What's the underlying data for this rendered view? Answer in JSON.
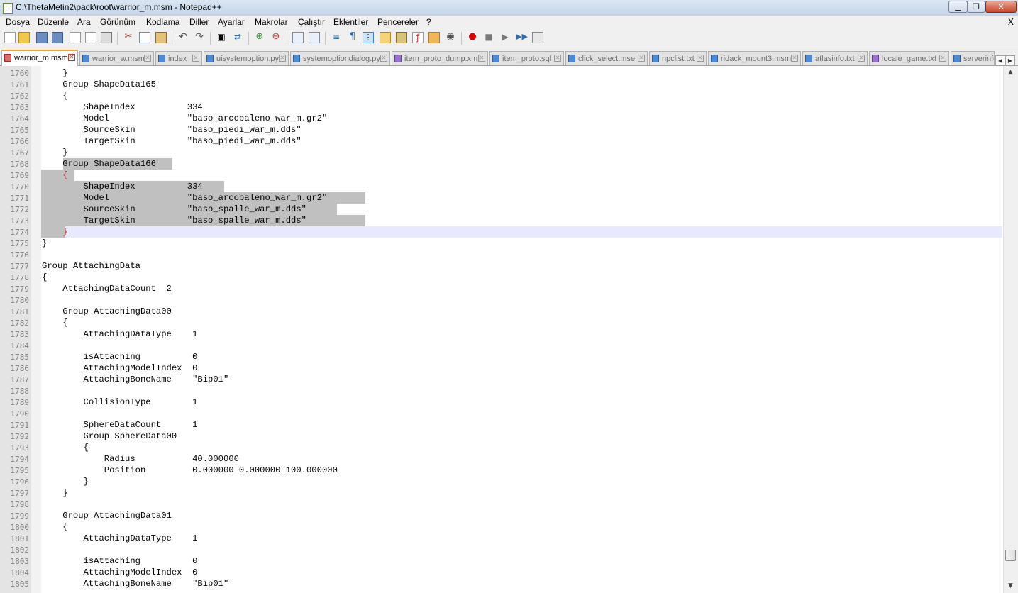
{
  "window": {
    "title": "C:\\ThetaMetin2\\pack\\root\\warrior_m.msm - Notepad++",
    "min_label": "▁",
    "max_label": "❐",
    "close_label": "✕"
  },
  "menu": {
    "items": [
      "Dosya",
      "Düzenle",
      "Ara",
      "Görünüm",
      "Kodlama",
      "Diller",
      "Ayarlar",
      "Makrolar",
      "Çalıştır",
      "Eklentiler",
      "Pencereler",
      "?"
    ],
    "close": "X"
  },
  "toolbar": {
    "icons": [
      "new-file-icon",
      "open-file-icon",
      "save-icon",
      "save-all-icon",
      "close-icon",
      "close-all-icon",
      "print-icon",
      "cut-icon",
      "copy-icon",
      "paste-icon",
      "undo-icon",
      "redo-icon",
      "find-icon",
      "replace-icon",
      "zoom-in-icon",
      "zoom-out-icon",
      "sync-vertical-icon",
      "sync-horizontal-icon",
      "word-wrap-icon",
      "show-all-chars-icon",
      "indent-guide-icon",
      "user-lang-icon",
      "doc-map-icon",
      "function-list-icon",
      "folder-workspace-icon",
      "monitor-icon",
      "record-macro-icon",
      "stop-macro-icon",
      "play-macro-icon",
      "run-macro-multiple-icon",
      "save-macro-icon"
    ]
  },
  "tabs": [
    {
      "label": "warrior_m.msm",
      "icon": "red",
      "active": true
    },
    {
      "label": "warrior_w.msm",
      "icon": "blue",
      "active": false
    },
    {
      "label": "index",
      "icon": "blue",
      "active": false
    },
    {
      "label": "uisystemoption.py",
      "icon": "blue",
      "active": false
    },
    {
      "label": "systemoptiondialog.py",
      "icon": "blue",
      "active": false
    },
    {
      "label": "item_proto_dump.xml",
      "icon": "purple",
      "active": false
    },
    {
      "label": "item_proto.sql",
      "icon": "blue",
      "active": false
    },
    {
      "label": "click_select.mse",
      "icon": "blue",
      "active": false
    },
    {
      "label": "npclist.txt",
      "icon": "blue",
      "active": false
    },
    {
      "label": "ridack_mount3.msm",
      "icon": "blue",
      "active": false
    },
    {
      "label": "atlasinfo.txt",
      "icon": "blue",
      "active": false
    },
    {
      "label": "locale_game.txt",
      "icon": "purple",
      "active": false
    },
    {
      "label": "serverinfo",
      "icon": "blue",
      "active": false
    }
  ],
  "editor": {
    "lines": [
      {
        "n": "1760",
        "text": "    }"
      },
      {
        "n": "1761",
        "text": "    Group ShapeData165"
      },
      {
        "n": "1762",
        "text": "    {"
      },
      {
        "n": "1763",
        "text": "        ShapeIndex          334"
      },
      {
        "n": "1764",
        "text": "        Model               \"baso_arcobaleno_war_m.gr2\""
      },
      {
        "n": "1765",
        "text": "        SourceSkin          \"baso_piedi_war_m.dds\""
      },
      {
        "n": "1766",
        "text": "        TargetSkin          \"baso_piedi_war_m.dds\""
      },
      {
        "n": "1767",
        "text": "    }"
      },
      {
        "n": "1768",
        "text": "    Group ShapeData166"
      },
      {
        "n": "1769",
        "text": "    {"
      },
      {
        "n": "1770",
        "text": "        ShapeIndex          334"
      },
      {
        "n": "1771",
        "text": "        Model               \"baso_arcobaleno_war_m.gr2\""
      },
      {
        "n": "1772",
        "text": "        SourceSkin          \"baso_spalle_war_m.dds\""
      },
      {
        "n": "1773",
        "text": "        TargetSkin          \"baso_spalle_war_m.dds\""
      },
      {
        "n": "1774",
        "text": "    }"
      },
      {
        "n": "1775",
        "text": "}"
      },
      {
        "n": "1776",
        "text": ""
      },
      {
        "n": "1777",
        "text": "Group AttachingData"
      },
      {
        "n": "1778",
        "text": "{"
      },
      {
        "n": "1779",
        "text": "    AttachingDataCount  2"
      },
      {
        "n": "1780",
        "text": ""
      },
      {
        "n": "1781",
        "text": "    Group AttachingData00"
      },
      {
        "n": "1782",
        "text": "    {"
      },
      {
        "n": "1783",
        "text": "        AttachingDataType    1"
      },
      {
        "n": "1784",
        "text": ""
      },
      {
        "n": "1785",
        "text": "        isAttaching          0"
      },
      {
        "n": "1786",
        "text": "        AttachingModelIndex  0"
      },
      {
        "n": "1787",
        "text": "        AttachingBoneName    \"Bip01\""
      },
      {
        "n": "1788",
        "text": ""
      },
      {
        "n": "1789",
        "text": "        CollisionType        1"
      },
      {
        "n": "1790",
        "text": ""
      },
      {
        "n": "1791",
        "text": "        SphereDataCount      1"
      },
      {
        "n": "1792",
        "text": "        Group SphereData00"
      },
      {
        "n": "1793",
        "text": "        {"
      },
      {
        "n": "1794",
        "text": "            Radius           40.000000"
      },
      {
        "n": "1795",
        "text": "            Position         0.000000 0.000000 100.000000"
      },
      {
        "n": "1796",
        "text": "        }"
      },
      {
        "n": "1797",
        "text": "    }"
      },
      {
        "n": "1798",
        "text": ""
      },
      {
        "n": "1799",
        "text": "    Group AttachingData01"
      },
      {
        "n": "1800",
        "text": "    {"
      },
      {
        "n": "1801",
        "text": "        AttachingDataType    1"
      },
      {
        "n": "1802",
        "text": ""
      },
      {
        "n": "1803",
        "text": "        isAttaching          0"
      },
      {
        "n": "1804",
        "text": "        AttachingModelIndex  0"
      },
      {
        "n": "1805",
        "text": "        AttachingBoneName    \"Bip01\""
      }
    ],
    "current_line": "1774",
    "scroll_position": 0.95
  },
  "scrollbar": {
    "up": "▲",
    "down": "▼"
  },
  "tab_scroll": {
    "left": "◀",
    "right": "▶"
  }
}
